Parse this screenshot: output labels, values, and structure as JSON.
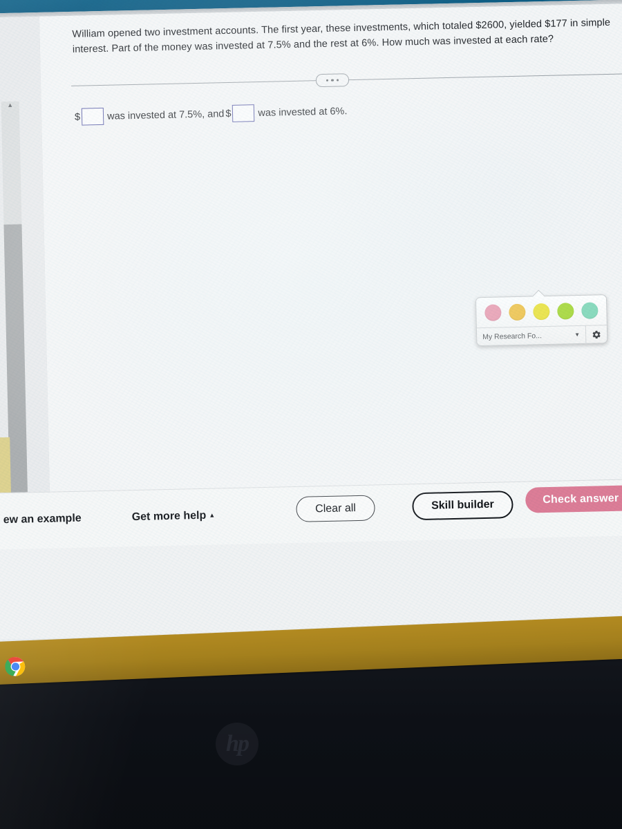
{
  "window": {
    "top_band_color": "#0f6188",
    "taskbar_color": "#a4801d",
    "bezel_color": "#0d1016",
    "laptop_brand": "hp"
  },
  "problem": {
    "statement": "William opened two investment accounts. The first year, these investments, which totaled $2600, yielded $177 in simple interest. Part of the money was invested at 7.5% and the rest at 6%. How much was invested at each rate?",
    "divider_dots": "•••"
  },
  "answer": {
    "dollar_sign_1": "$",
    "blank_1_value": "",
    "segment_1": "was invested at 7.5%, and",
    "dollar_sign_2": "$",
    "blank_2_value": "",
    "segment_2": "was invested at 6%."
  },
  "highlighter_popup": {
    "folder_label": "My Research Fo...",
    "dropdown_caret": "▼",
    "gear_icon": "gear-icon",
    "swatches": [
      {
        "name": "pink",
        "color": "#eb9bb0"
      },
      {
        "name": "orange",
        "color": "#f1c349"
      },
      {
        "name": "yellow",
        "color": "#ece33f"
      },
      {
        "name": "lime",
        "color": "#a8d93c"
      },
      {
        "name": "mint",
        "color": "#85d9bb"
      }
    ]
  },
  "action_bar": {
    "view_example_label": "ew an example",
    "get_more_help_label": "Get more help",
    "get_more_help_caret": "▲",
    "clear_all_label": "Clear all",
    "skill_builder_label": "Skill builder",
    "check_answer_label": "Check answer",
    "check_answer_color": "#dd7d97"
  },
  "scrollbar": {
    "up_arrow": "▲",
    "down_arrow": "▼"
  }
}
